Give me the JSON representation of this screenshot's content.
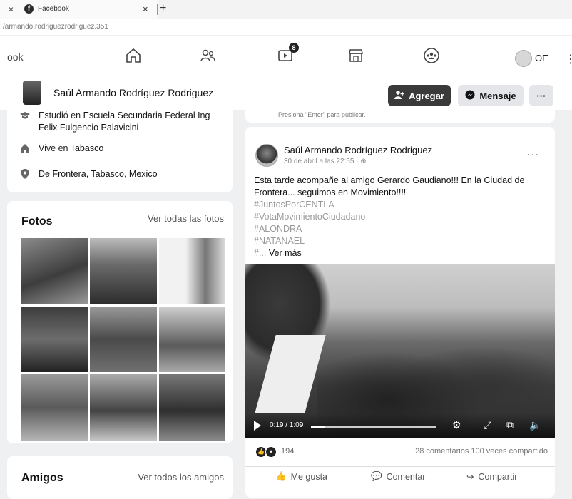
{
  "browser": {
    "tab_close": "×",
    "tab_title": "Facebook",
    "tab_close2": "×",
    "new_tab": "+",
    "url": "/armando.rodriguezrodriguez.351"
  },
  "nav": {
    "brand": "ook",
    "watch_badge": "8",
    "user_initials": "OE"
  },
  "profile": {
    "name": "Saúl Armando Rodríguez Rodriguez",
    "add_button": "Agregar",
    "message_button": "Mensaje",
    "more_button": "···"
  },
  "intro": {
    "studied_prefix": "Estudió en",
    "studied_place": "Escuela Secundaria Federal Ing Felix Fulgencio Palavicini",
    "lives_prefix": "Vive en",
    "lives_place": "Tabasco",
    "from_prefix": "De",
    "from_place": "Frontera, Tabasco, Mexico"
  },
  "photos": {
    "heading": "Fotos",
    "see_all": "Ver todas las fotos"
  },
  "friends": {
    "heading": "Amigos",
    "see_all": "Ver todos los amigos"
  },
  "composer": {
    "hint": "Presiona \"Enter\" para publicar."
  },
  "post": {
    "author": "Saúl Armando Rodríguez Rodriguez",
    "date": "30 de abril a las 22:55 · ",
    "more": "···",
    "text": "Esta tarde acompañe al amigo Gerardo Gaudiano!!! En la Ciudad de Frontera... seguimos en Movimiento!!!!",
    "hashtags": [
      "#JuntosPorCENTLA",
      "#VotaMovimientoCiudadano",
      "#ALONDRA",
      "#NATANAEL"
    ],
    "hashtag_last_prefix": "#...",
    "see_more": "Ver más",
    "video_time": "0:19 / 1:09",
    "reaction_count": "194",
    "comments_shares": "28 comentarios  100 veces compartido",
    "like": "Me gusta",
    "comment": "Comentar",
    "share": "Compartir"
  }
}
